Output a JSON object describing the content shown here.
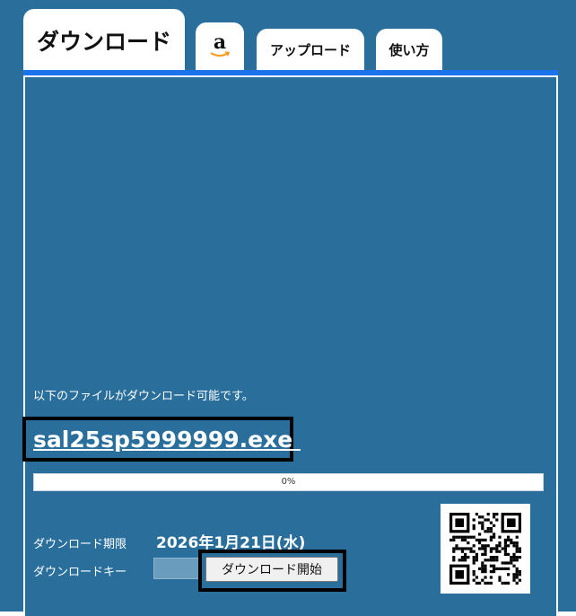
{
  "tabs": {
    "download": "ダウンロード",
    "amazon_icon": "amazon-logo",
    "amazon_letter": "a",
    "upload": "アップロード",
    "howto": "使い方"
  },
  "notice": "以下のファイルがダウンロード可能です。",
  "file": {
    "name": "sal25sp5999999.exe "
  },
  "progress": {
    "value": 0,
    "label": "0%"
  },
  "expiry": {
    "label": "ダウンロード期限",
    "value": "2026年1月21日(水)"
  },
  "key": {
    "label": "ダウンロードキー",
    "value": ""
  },
  "start_button": "ダウンロード開始",
  "colors": {
    "background": "#2a6f9b",
    "tab_accent": "#1a73e8",
    "highlight_border": "#000000"
  }
}
